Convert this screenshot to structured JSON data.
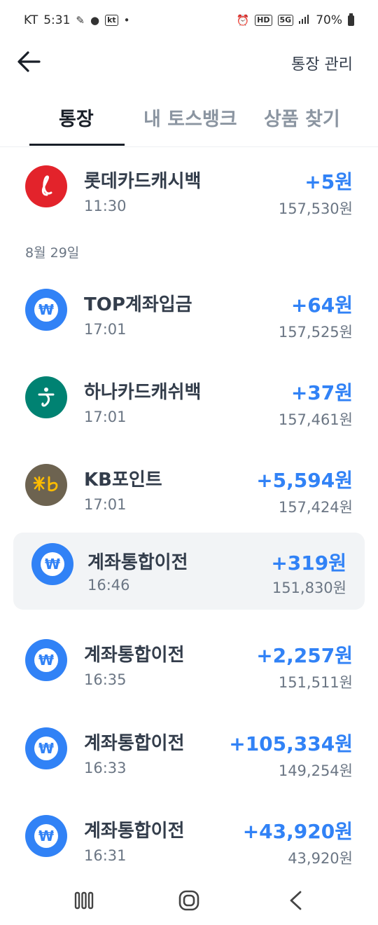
{
  "status_bar": {
    "carrier": "KT",
    "time": "5:31",
    "kt_badge": "kt",
    "hd_badge": "HD",
    "network": "5G",
    "battery": "70%"
  },
  "header": {
    "manage_label": "통장 관리"
  },
  "tabs": [
    {
      "label": "통장",
      "active": true
    },
    {
      "label": "내 토스뱅크",
      "active": false
    },
    {
      "label": "상품 찾기",
      "active": false
    }
  ],
  "transactions": {
    "first": {
      "name": "롯데카드캐시백",
      "time": "11:30",
      "amount": "+5원",
      "balance": "157,530원",
      "icon": "lotte-card-logo"
    },
    "date_label": "8월 29일",
    "items": [
      {
        "name": "TOP계좌입금",
        "time": "17:01",
        "amount": "+64원",
        "balance": "157,525원",
        "icon": "won-icon"
      },
      {
        "name": "하나카드캐쉬백",
        "time": "17:01",
        "amount": "+37원",
        "balance": "157,461원",
        "icon": "hana-card-logo"
      },
      {
        "name": "KB포인트",
        "time": "17:01",
        "amount": "+5,594원",
        "balance": "157,424원",
        "icon": "kb-logo"
      },
      {
        "name": "계좌통합이전",
        "time": "16:46",
        "amount": "+319원",
        "balance": "151,830원",
        "icon": "won-icon"
      },
      {
        "name": "계좌통합이전",
        "time": "16:35",
        "amount": "+2,257원",
        "balance": "151,511원",
        "icon": "won-icon"
      },
      {
        "name": "계좌통합이전",
        "time": "16:33",
        "amount": "+105,334원",
        "balance": "149,254원",
        "icon": "won-icon"
      },
      {
        "name": "계좌통합이전",
        "time": "16:31",
        "amount": "+43,920원",
        "balance": "43,920원",
        "icon": "won-icon"
      }
    ]
  },
  "nav": {
    "recents": "recents-icon",
    "home": "home-icon",
    "back": "back-icon"
  },
  "colors": {
    "accent": "#3182f6",
    "lotte": "#e3232b",
    "hana": "#008272",
    "kb": "#6d6350",
    "highlight_bg": "#f2f4f6"
  }
}
